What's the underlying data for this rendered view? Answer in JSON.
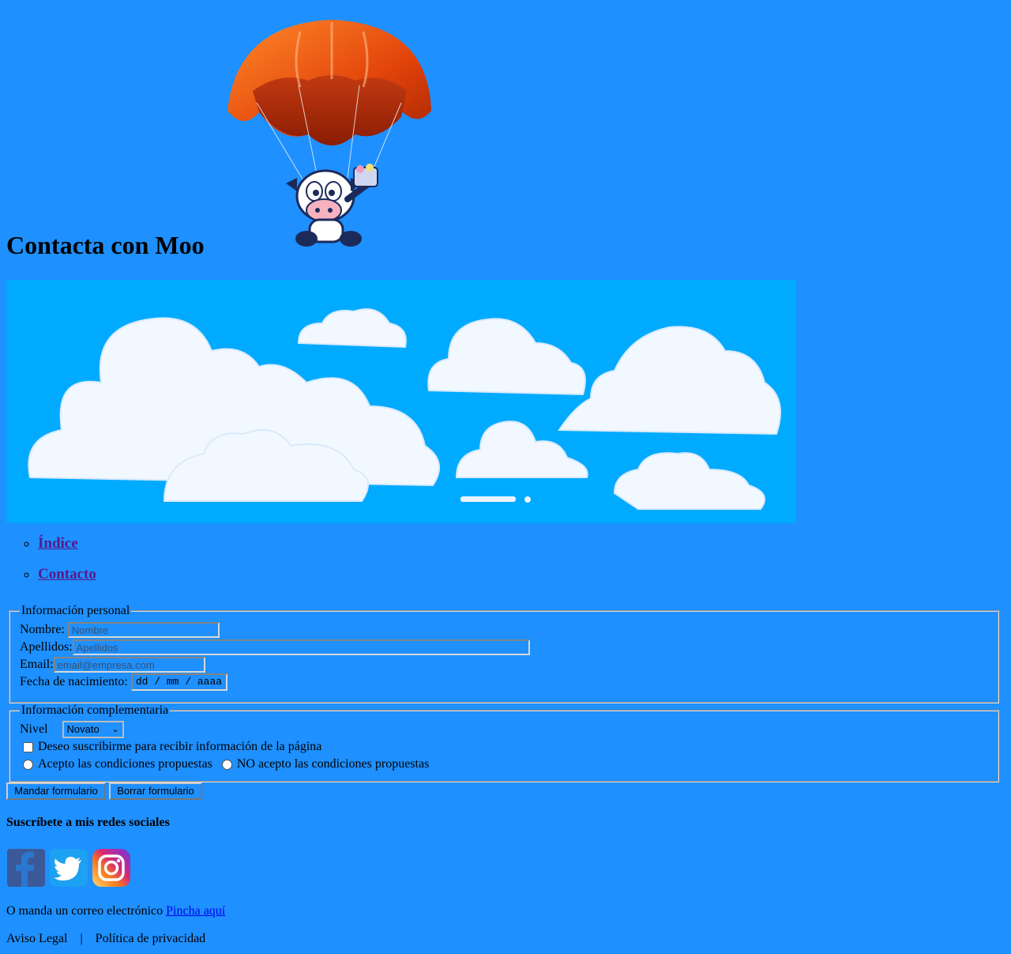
{
  "header": {
    "title": "Contacta con Moo"
  },
  "nav": {
    "items": [
      {
        "label": "Índice"
      },
      {
        "label": "Contacto"
      }
    ]
  },
  "form": {
    "personal": {
      "legend": "Información personal",
      "nombre_label": "Nombre:",
      "nombre_placeholder": "Nombre",
      "apellidos_label": "Apellidos:",
      "apellidos_placeholder": "Apellidos",
      "email_label": "Email:",
      "email_placeholder": "email@empresa.com",
      "fecha_label": "Fecha de nacimiento:",
      "fecha_placeholder": "dd / mm / aaaa"
    },
    "complementaria": {
      "legend": "Información complementaria",
      "nivel_label": "Nivel",
      "nivel_selected": "Novato",
      "subscribe_label": "Deseo suscribirme para recibir información de la página",
      "accept_label": "Acepto las condiciones propuestas",
      "reject_label": "NO acepto las condiciones propuestas"
    },
    "submit_label": "Mandar formulario",
    "reset_label": "Borrar formulario"
  },
  "social": {
    "title": "Suscríbete a mis redes sociales",
    "icons": [
      "facebook-icon",
      "twitter-icon",
      "instagram-icon"
    ]
  },
  "mail": {
    "text": "O manda un correo electrónico ",
    "link": "Pincha aquí"
  },
  "footer": {
    "legal": "Aviso Legal",
    "separator": "|",
    "privacy": "Política de privacidad"
  },
  "colors": {
    "background": "#1e90ff",
    "sky": "#00aaff",
    "link": "#0000ee",
    "visited": "#551a8b"
  }
}
